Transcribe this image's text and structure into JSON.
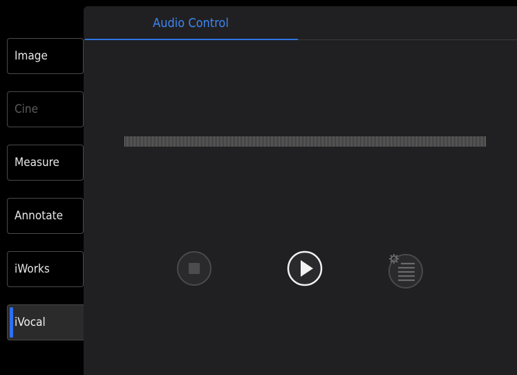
{
  "sidebar": {
    "items": [
      {
        "label": "Image",
        "state": "normal"
      },
      {
        "label": "Cine",
        "state": "disabled"
      },
      {
        "label": "Measure",
        "state": "normal"
      },
      {
        "label": "Annotate",
        "state": "normal"
      },
      {
        "label": "iWorks",
        "state": "normal"
      },
      {
        "label": "iVocal",
        "state": "active"
      }
    ]
  },
  "tabs": [
    {
      "label": "Audio Control",
      "active": true
    }
  ],
  "controls": {
    "icons": [
      "stop-icon",
      "play-icon",
      "settings-list-icon"
    ],
    "stop_enabled": false,
    "play_enabled": true,
    "settings_enabled": false
  },
  "colors": {
    "accent": "#2f6ff0",
    "tab_text": "#3f86f0",
    "panel_bg": "#202022",
    "disabled_text": "#5c5c5c"
  }
}
